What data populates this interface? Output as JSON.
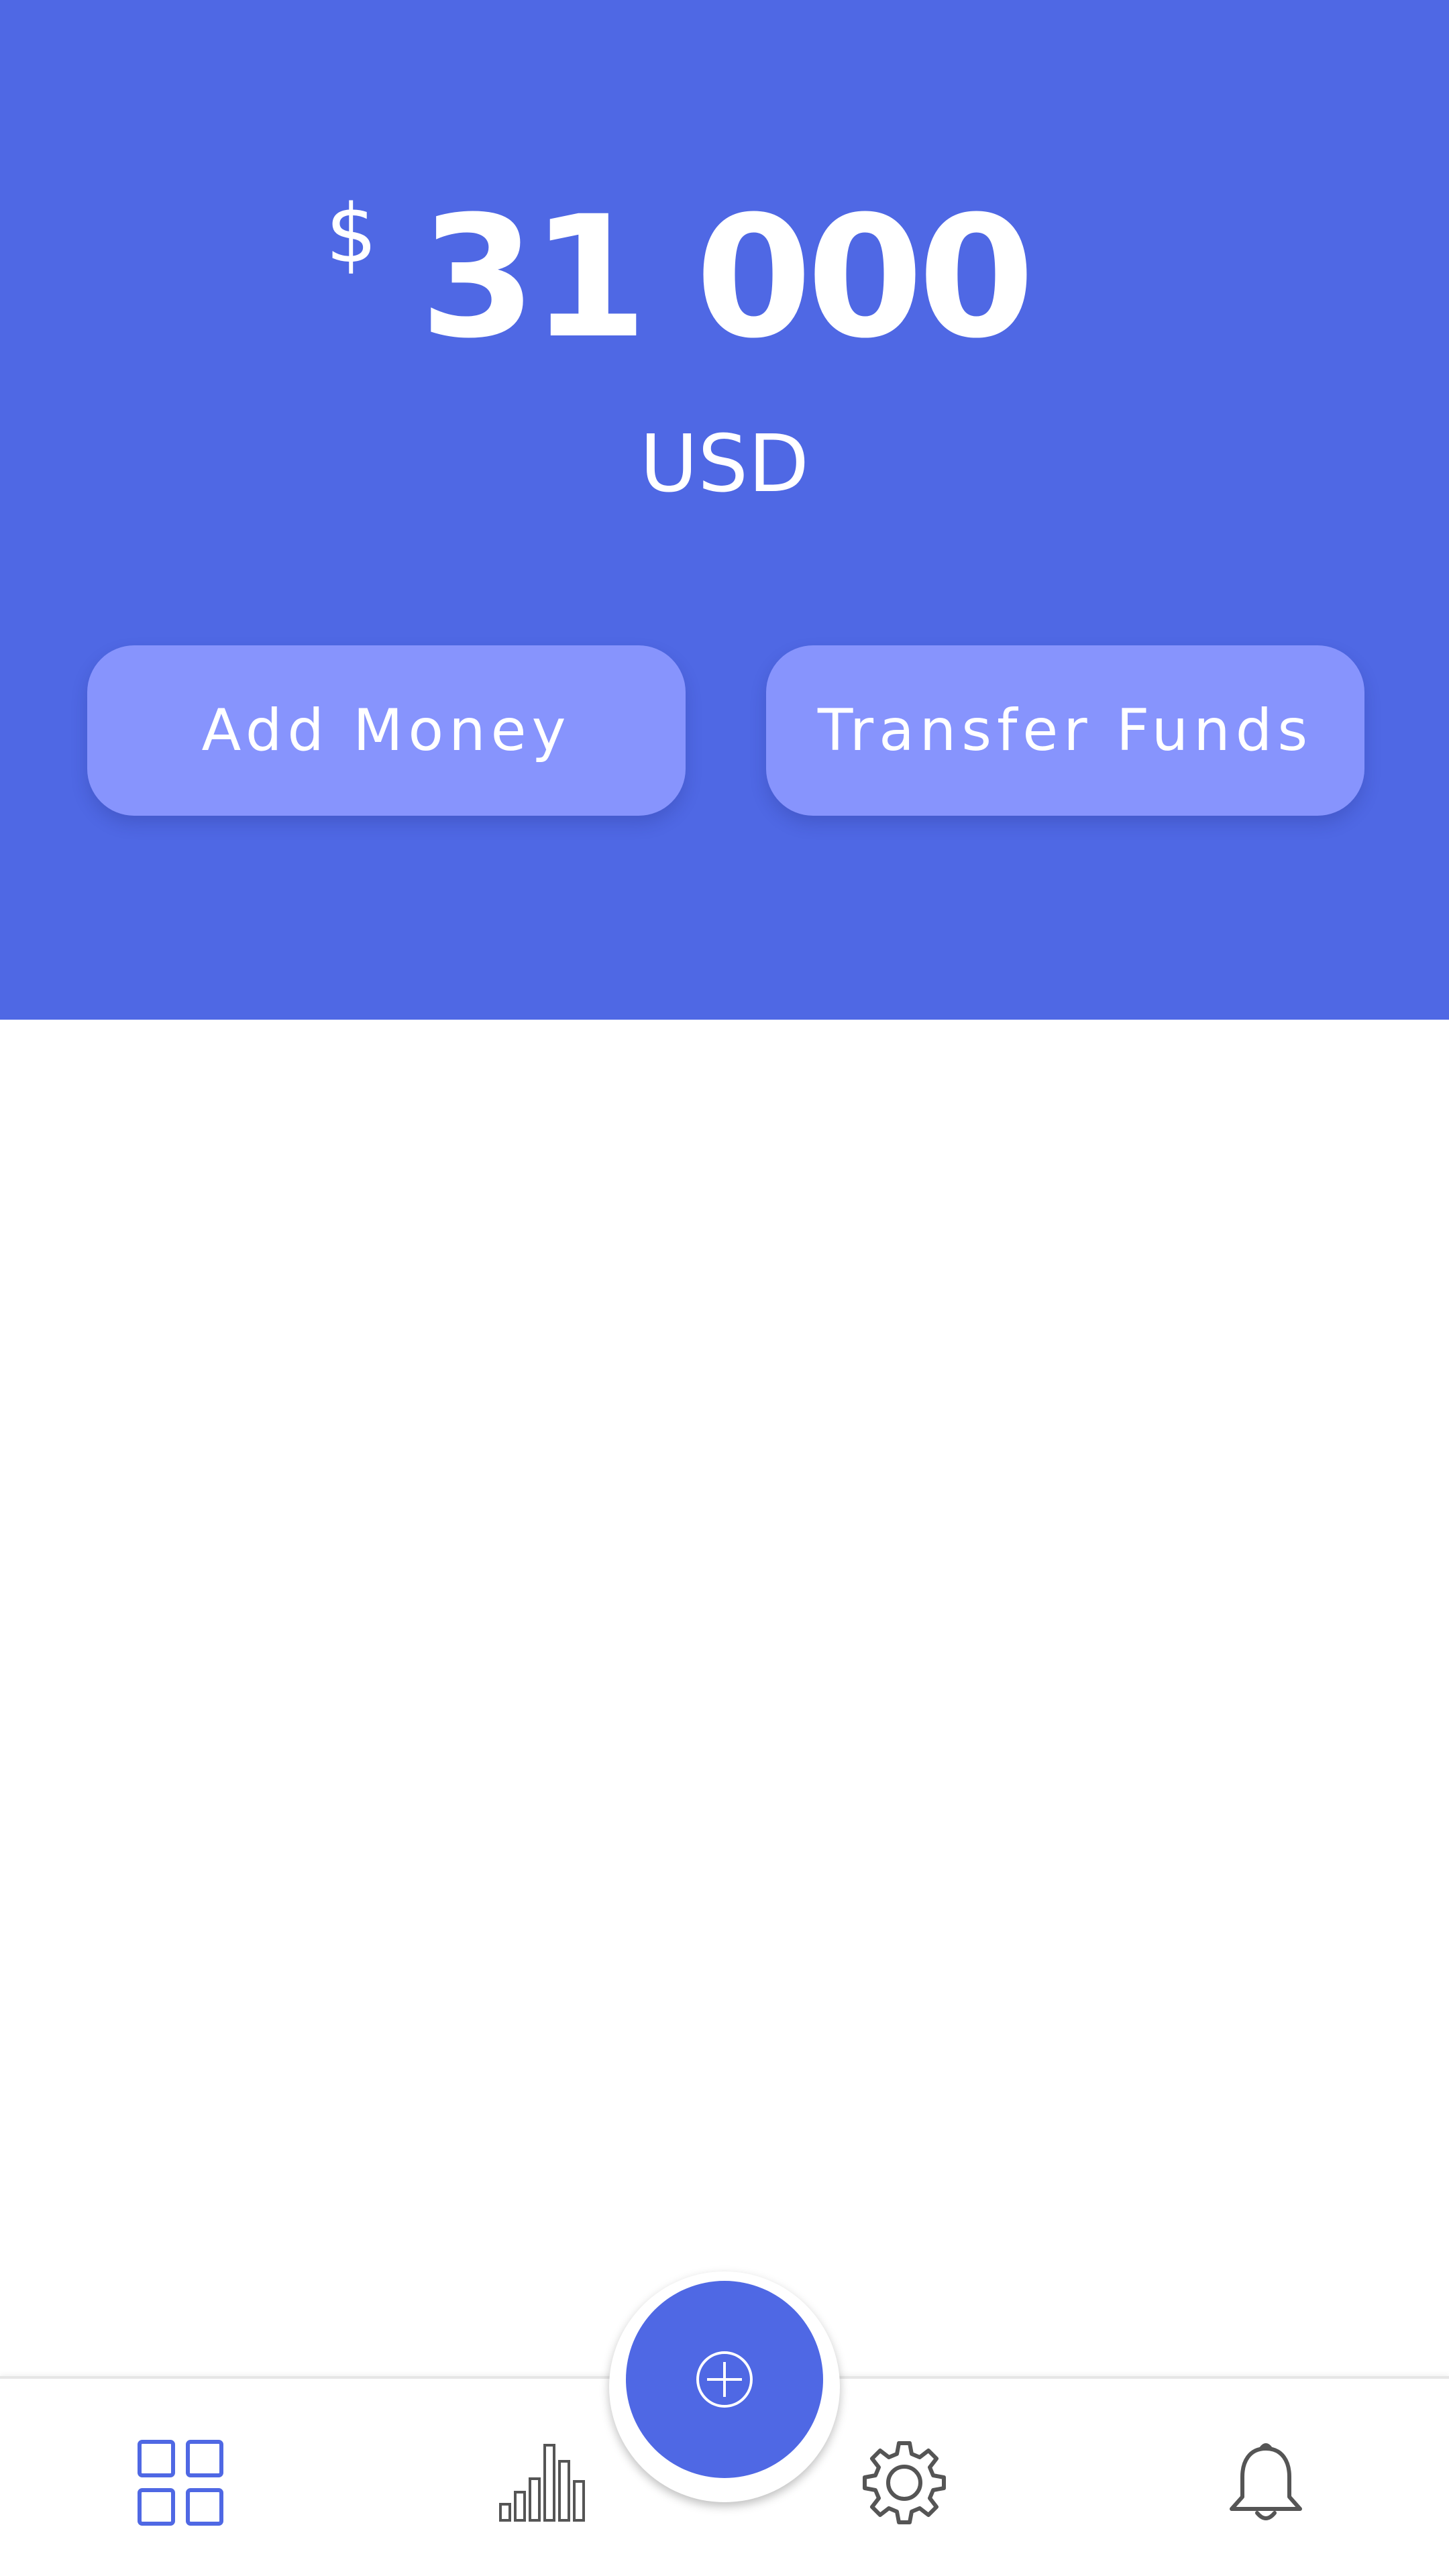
{
  "balance": {
    "currency_symbol": "$",
    "amount": "31 000",
    "currency_code": "USD"
  },
  "actions": {
    "add_money_label": "Add Money",
    "transfer_funds_label": "Transfer Funds"
  },
  "bottom_nav": {
    "items": [
      {
        "icon": "dashboard-grid-icon",
        "active": true
      },
      {
        "icon": "bar-chart-icon",
        "active": false
      },
      {
        "icon": "add-circle-icon",
        "active": false
      },
      {
        "icon": "gear-icon",
        "active": false
      },
      {
        "icon": "bell-icon",
        "active": false
      }
    ]
  },
  "colors": {
    "primary": "#4f68e4",
    "button": "#8794fd",
    "icon_active": "#4f68e4",
    "icon_inactive": "#555555",
    "background": "#ffffff"
  }
}
